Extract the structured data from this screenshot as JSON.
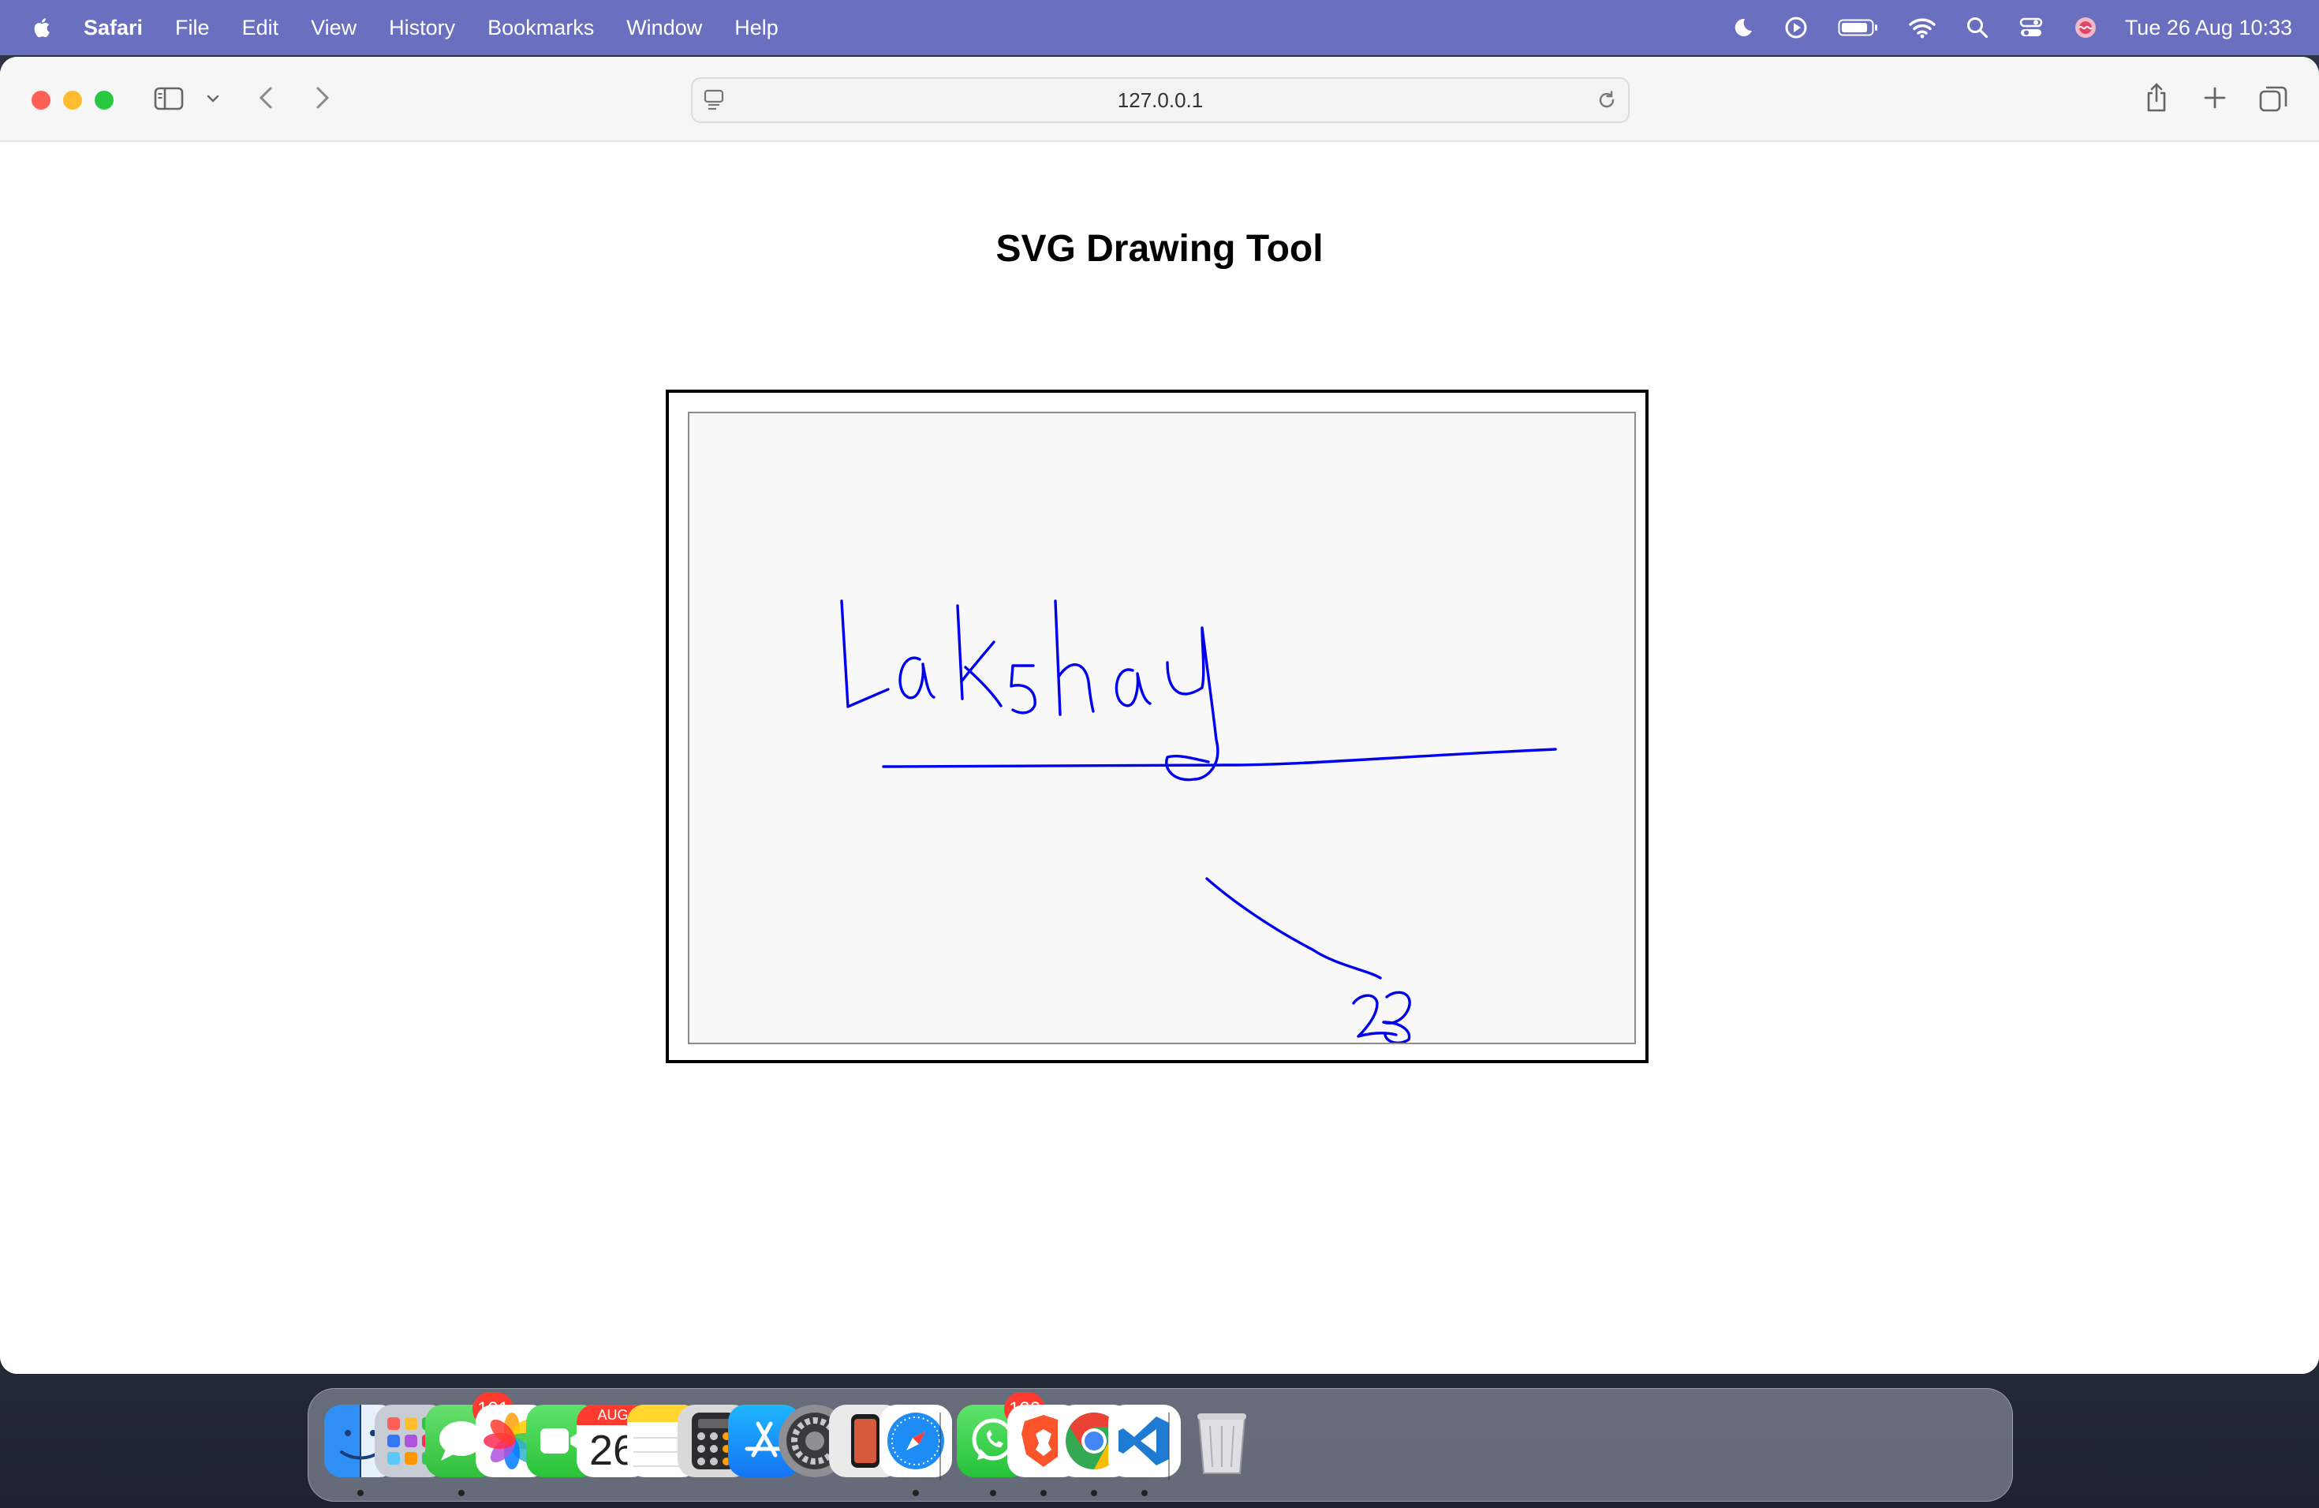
{
  "menubar": {
    "app_name": "Safari",
    "items": [
      "File",
      "Edit",
      "View",
      "History",
      "Bookmarks",
      "Window",
      "Help"
    ],
    "clock": "Tue 26 Aug  10:33"
  },
  "toolbar": {
    "url": "127.0.0.1"
  },
  "page": {
    "title": "SVG Drawing Tool",
    "stroke_color": "#0000ee"
  },
  "dock": {
    "calendar_month": "AUG",
    "calendar_day": "26",
    "messages_badge": "101",
    "whatsapp_badge": "120"
  },
  "colors": {
    "menubar": "#6a6fbf",
    "close": "#fe5f57",
    "minimize": "#febc2e",
    "maximize": "#28c840"
  }
}
